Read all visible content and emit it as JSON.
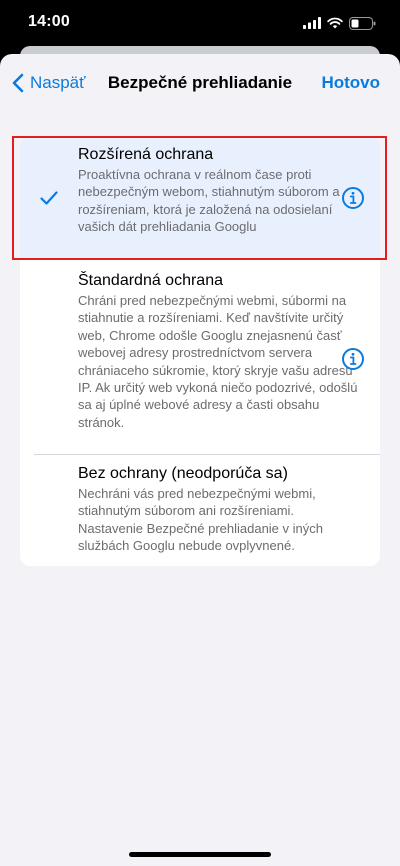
{
  "status_bar": {
    "time": "14:00"
  },
  "nav": {
    "back_label": "Naspäť",
    "title": "Bezpečné prehliadanie",
    "done_label": "Hotovo"
  },
  "options": [
    {
      "title": "Rozšírená ochrana",
      "description": "Proaktívna ochrana v reálnom čase proti nebezpečným webom, stiahnutým súborom a rozšíreniam, ktorá je založená na odosielaní vašich dát prehliadania Googlu",
      "selected": true
    },
    {
      "title": "Štandardná ochrana",
      "description": "Chráni pred nebezpečnými webmi, súbormi na stiahnutie a rozšíreniami. Keď navštívite určitý web, Chrome odošle Googlu znejasnenú časť webovej adresy prostredníctvom servera chrániaceho súkromie, ktorý skryje vašu adresu IP. Ak určitý web vykoná niečo podozrivé, odošlú sa aj úplné webové adresy a časti obsahu stránok.",
      "selected": false
    },
    {
      "title": "Bez ochrany (neodporúča sa)",
      "description": "Nechráni vás pred nebezpečnými webmi, stiahnutým súborom ani rozšíreniami. Nastavenie Bezpečné prehliadanie v iných službách Googlu nebude ovplyvnené.",
      "selected": false
    }
  ],
  "colors": {
    "accent": "#0a7bde",
    "selected_bg": "#e8f0fe",
    "highlight_border": "#e02020",
    "background": "#f2f2f7"
  },
  "icons": [
    "back-chevron-icon",
    "checkmark-icon",
    "info-icon",
    "signal-icon",
    "wifi-icon",
    "battery-icon"
  ]
}
